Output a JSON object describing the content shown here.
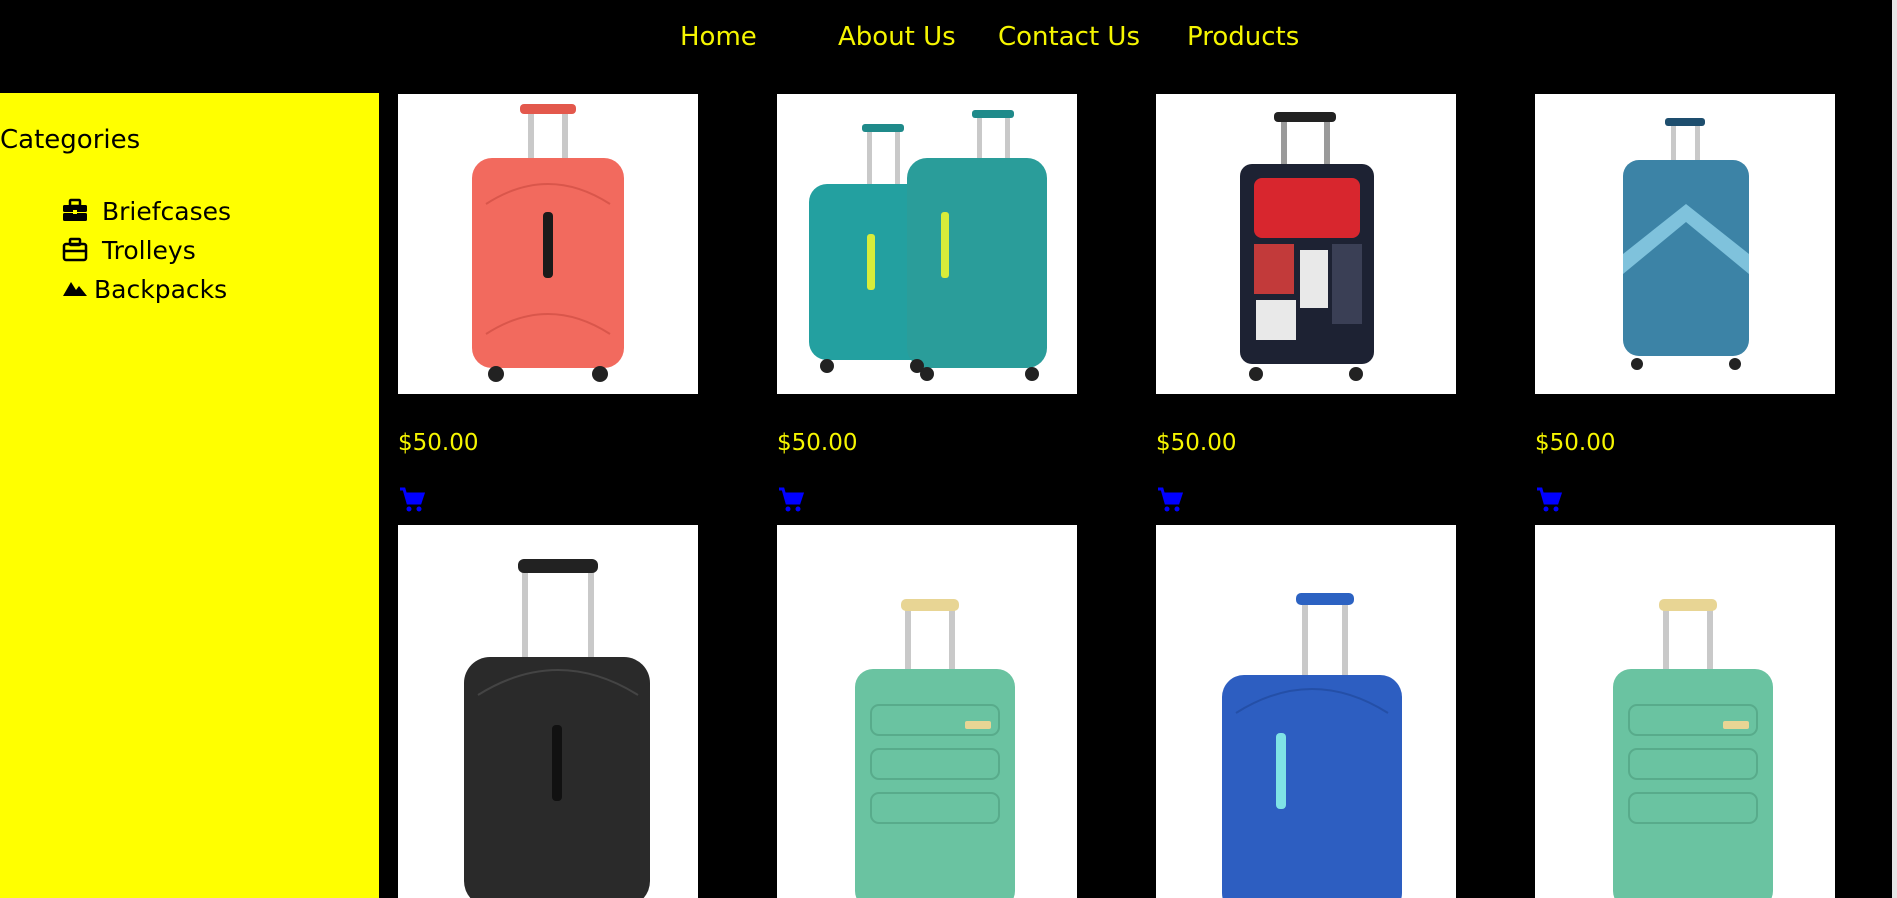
{
  "nav": {
    "home": "Home",
    "about": "About Us",
    "contact": "Contact Us",
    "products": "Products"
  },
  "sidebar": {
    "title": "Categories",
    "items": [
      {
        "label": "Briefcases",
        "icon": "briefcase-icon"
      },
      {
        "label": "Trolleys",
        "icon": "luggage-icon"
      },
      {
        "label": "Backpacks",
        "icon": "mountain-icon"
      }
    ]
  },
  "products": [
    {
      "price": "$50.00",
      "image": "coral-trolley"
    },
    {
      "price": "$50.00",
      "image": "teal-trolley-pair"
    },
    {
      "price": "$50.00",
      "image": "printed-soft-trolley"
    },
    {
      "price": "$50.00",
      "image": "blue-chevron-trolley"
    },
    {
      "image": "black-trolley"
    },
    {
      "image": "mint-trolley"
    },
    {
      "image": "royal-blue-trolley"
    },
    {
      "image": "mint-trolley"
    }
  ],
  "colors": {
    "accent": "#f5f500",
    "sidebar": "#ffff00",
    "background": "#000000",
    "cart": "#0000ff"
  }
}
